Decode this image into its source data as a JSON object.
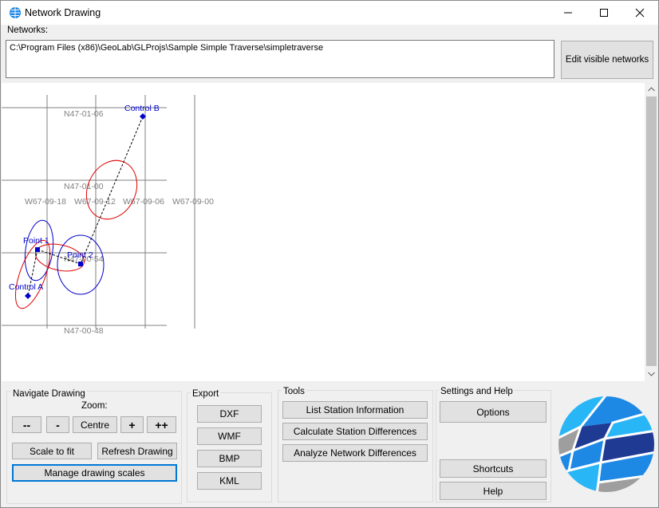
{
  "window": {
    "title": "Network Drawing"
  },
  "networks": {
    "label": "Networks:",
    "path": "C:\\Program Files (x86)\\GeoLab\\GLProjs\\Sample Simple Traverse\\simpletraverse",
    "edit_button": "Edit visible networks"
  },
  "drawing": {
    "grid_labels": {
      "lat1": "N47-01-06",
      "lat2": "N47-01-00",
      "lat3": "N47-00-54",
      "lat4": "N47-00-48",
      "lon1": "W67-09-18",
      "lon2": "W67-09-12",
      "lon3": "W67-09-06",
      "lon4": "W67-09-00"
    },
    "stations": {
      "control_b": "Control B",
      "point_1": "Point 1",
      "point_2": "Point 2",
      "control_a": "Control A"
    },
    "colors": {
      "station": "#0000cc",
      "relative_ellipse": "#dd0000",
      "absolute_ellipse": "#0000cc",
      "grid": "#808080"
    }
  },
  "navigate": {
    "title": "Navigate Drawing",
    "zoom_label": "Zoom:",
    "zoom_out_more": "--",
    "zoom_out": "-",
    "centre": "Centre",
    "zoom_in": "+",
    "zoom_in_more": "++",
    "scale_to_fit": "Scale to fit",
    "refresh": "Refresh Drawing",
    "manage_scales": "Manage drawing scales"
  },
  "export": {
    "title": "Export",
    "dxf": "DXF",
    "wmf": "WMF",
    "bmp": "BMP",
    "kml": "KML"
  },
  "tools": {
    "title": "Tools",
    "list_station": "List Station Information",
    "calc_diff": "Calculate Station Differences",
    "analyze_diff": "Analyze Network Differences"
  },
  "settings": {
    "title": "Settings and Help",
    "options": "Options",
    "shortcuts": "Shortcuts",
    "help": "Help"
  },
  "logo": {
    "colors": [
      "#1f3a93",
      "#1e88e5",
      "#29b6f6",
      "#9e9e9e"
    ]
  }
}
